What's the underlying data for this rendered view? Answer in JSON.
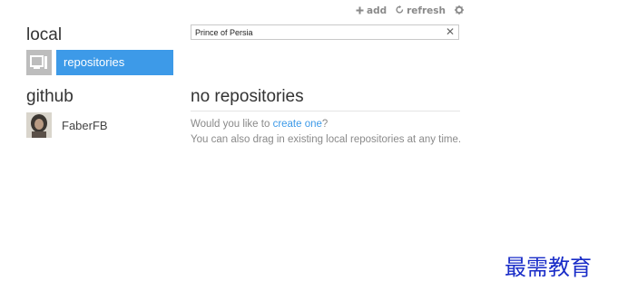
{
  "toolbar": {
    "add_label": "add",
    "refresh_label": "refresh",
    "add_icon": "plus-icon",
    "refresh_icon": "refresh-icon",
    "settings_icon": "gear-icon"
  },
  "search": {
    "value": "Prince of Persia",
    "clear_icon": "close-icon"
  },
  "sidebar": {
    "local_title": "local",
    "local_item_label": "repositories",
    "github_title": "github",
    "user_label": "FaberFB"
  },
  "main": {
    "title": "no repositories",
    "prompt_text": "Would you like to ",
    "create_link": "create one",
    "prompt_suffix": "?",
    "drag_text": "You can also drag in existing local repositories at any time."
  },
  "watermark": "最需教育",
  "colors": {
    "accent": "#3d9ae8",
    "muted_text": "#8a8a8a",
    "watermark": "#1a2dc8"
  }
}
